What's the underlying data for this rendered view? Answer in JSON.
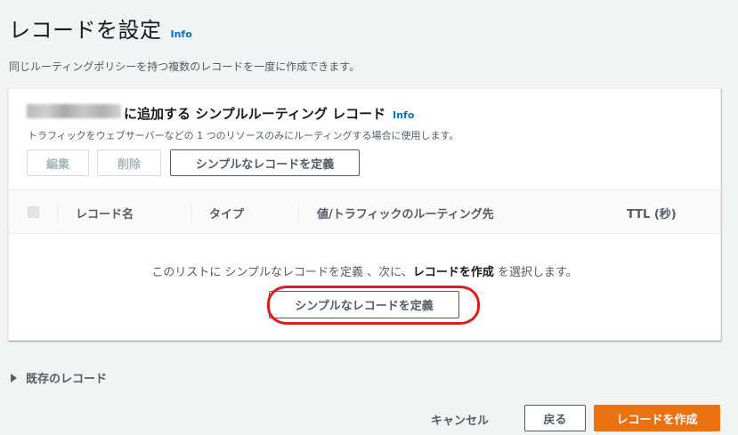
{
  "page": {
    "title": "レコードを設定",
    "info": "Info",
    "description": "同じルーティングポリシーを持つ複数のレコードを一度に作成できます。"
  },
  "panel": {
    "title": "に追加する シンプルルーティング レコード",
    "info": "Info",
    "description": "トラフィックをウェブサーバーなどの 1 つのリソースのみにルーティングする場合に使用します。",
    "actions": {
      "edit": "編集",
      "delete": "削除",
      "define": "シンプルなレコードを定義"
    },
    "table": {
      "columns": [
        "レコード名",
        "タイプ",
        "値/トラフィックのルーティング先",
        "TTL (秒)"
      ]
    },
    "empty": {
      "part1": "このリストに シンプルなレコードを定義 、次に、",
      "bold": "レコードを作成",
      "part2": " を選択します。",
      "button": "シンプルなレコードを定義"
    }
  },
  "existing_records": "既存のレコード",
  "footer": {
    "cancel": "キャンセル",
    "back": "戻る",
    "create": "レコードを作成"
  },
  "colors": {
    "primary": "#ec7211",
    "link": "#0073bb",
    "highlight": "#e01b1b"
  }
}
